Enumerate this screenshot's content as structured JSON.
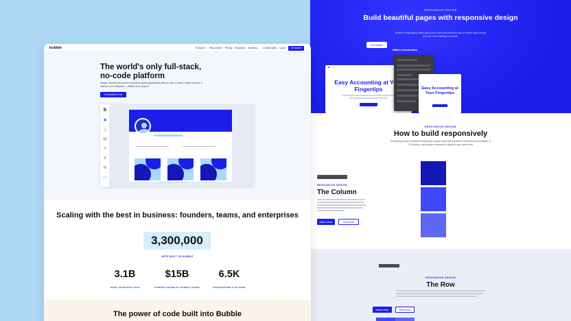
{
  "left_page": {
    "nav": {
      "logo": "bubble",
      "links": [
        "Product ▾",
        "Resources ▾",
        "Pricing",
        "Showcase",
        "Academy"
      ],
      "contact": "Contact sales",
      "login": "Log in",
      "signup": "Get started"
    },
    "hero": {
      "title": "The world's only full-stack, no-code platform",
      "subtitle": "Design, develop and launch production-grade applications without code. It doesn't matter if you're a startup or an enterprise — Bubble is for anyone.",
      "cta": "Get started for free"
    },
    "editor": {
      "logo": "b",
      "tools": [
        "close-icon",
        "shapes-icon",
        "database-icon",
        "pen-icon",
        "plug-icon",
        "settings-icon",
        "page-icon"
      ]
    },
    "stats": {
      "title": "Scaling with the best in business: founders, teams, and enterprises",
      "big_number": "3,300,000",
      "big_caption": "APPS BUILT ON BUBBLE",
      "items": [
        {
          "value": "3.1B",
          "label": "PAGE LOADS PER YEAR"
        },
        {
          "value": "$15B",
          "label": "FUNDING RAISED BY BUBBLE USERS"
        },
        {
          "value": "6.5K",
          "label": "INTEGRATIONS & PLUGINS"
        }
      ]
    },
    "power": {
      "title": "The power of code built into Bubble"
    }
  },
  "right_page": {
    "hero": {
      "eyebrow": "RESPONSIVE DESIGN",
      "title": "Build beautiful pages with responsive design",
      "subtitle": "Bubble's responsive editor gives you a fast and powerful way to create apps across devices, from desktop to mobile.",
      "cta_primary": "Get started",
      "cta_secondary": "Watch introduction",
      "mock_title": "Easy Accounting at Your Fingertips",
      "mock_title_small": "Easy Accounting at Your Fingertips"
    },
    "build": {
      "eyebrow": "RESPONSIVE DESIGN",
      "title": "How to build responsively",
      "subtitle": "Everything's built on Bubble's responsive engine: build with containers that follow the principles of CSS flexbox, and position elements to adapt to any screen size.",
      "column_eyebrow": "RESPONSIVE DESIGN",
      "column_title": "The Column",
      "btn_primary": "Watch demo",
      "btn_secondary": "Read docs"
    },
    "row": {
      "eyebrow": "RESPONSIVE DESIGN",
      "title": "The Row",
      "btn_primary": "Watch demo",
      "btn_secondary": "Read docs"
    }
  },
  "colors": {
    "brand_blue": "#1b1ee8",
    "light_blue": "#a6dbfb",
    "background": "#aed8f6"
  }
}
